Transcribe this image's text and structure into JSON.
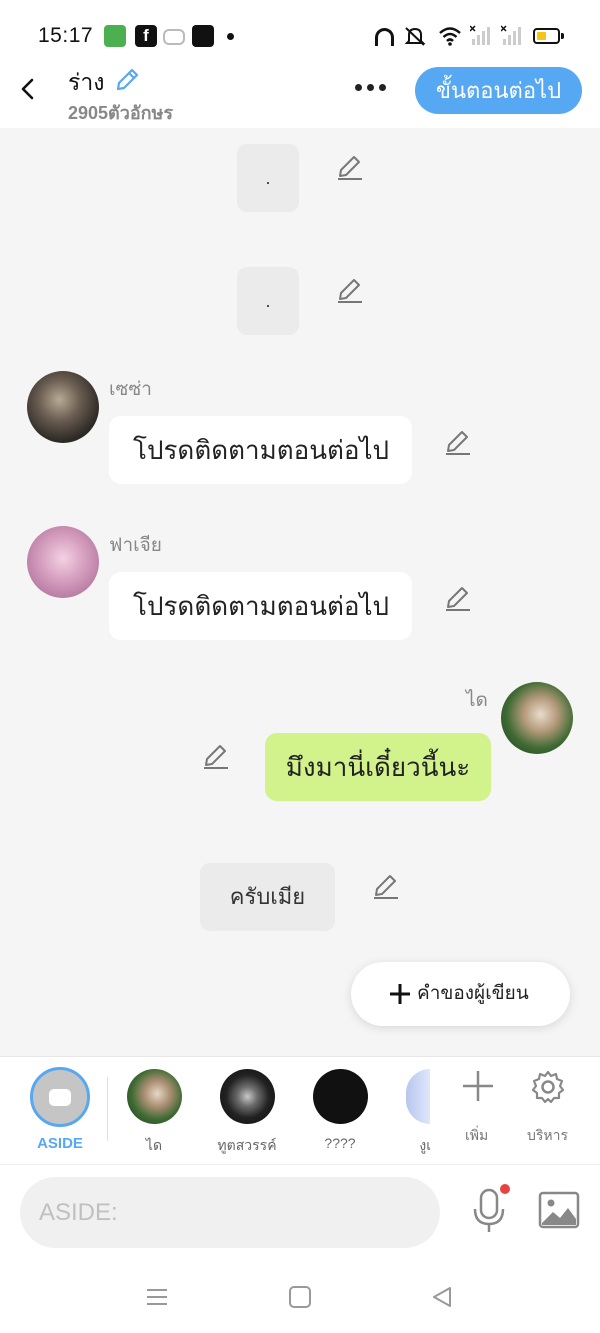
{
  "status_bar": {
    "time": "15:17",
    "fb_glyph": "f",
    "icons": [
      "app-icon",
      "facebook-icon",
      "game-icon",
      "app-icon",
      "headphones-icon",
      "bell-off-icon",
      "wifi-icon",
      "signal-icon",
      "signal-icon",
      "battery-icon"
    ]
  },
  "header": {
    "title": "ร่าง",
    "char_count": "2905ตัวอักษร",
    "next_button": "ขั้นตอนต่อไป"
  },
  "messages": [
    {
      "type": "aside",
      "text": "."
    },
    {
      "type": "aside",
      "text": "."
    },
    {
      "type": "left",
      "speaker": "เซซ่า",
      "text": "โปรดติดตามตอนต่อไป"
    },
    {
      "type": "left",
      "speaker": "ฟาเจีย",
      "text": "โปรดติดตามตอนต่อไป"
    },
    {
      "type": "right",
      "speaker": "ได",
      "text": "มึงมานี่เดี๋ยวนี้นะ"
    },
    {
      "type": "aside",
      "text": "ครับเมีย"
    }
  ],
  "author_button": "คำของผู้เขียน",
  "characters": {
    "aside_label": "ASIDE",
    "items": [
      {
        "name": "ได"
      },
      {
        "name": "ทูตสวรรค์"
      },
      {
        "name": "????"
      },
      {
        "name": "งูเ"
      }
    ],
    "add_label": "เพิ่ม",
    "manage_label": "บริหาร"
  },
  "input": {
    "placeholder": "ASIDE:"
  },
  "colors": {
    "accent": "#57a8f2",
    "right_bubble": "#d2f28c",
    "mic_badge": "#e84343"
  }
}
